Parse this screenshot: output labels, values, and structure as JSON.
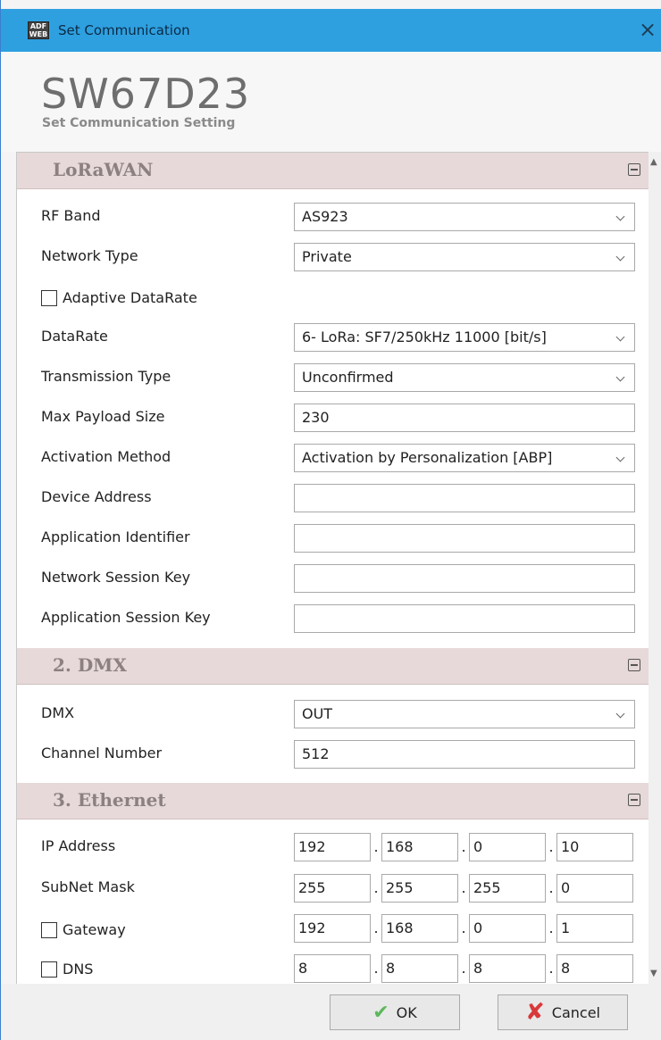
{
  "window": {
    "title": "Set Communication",
    "icon_text": "ADF WEB"
  },
  "header": {
    "product": "SW67D23",
    "subtitle": "Set Communication Setting"
  },
  "sections": {
    "lorawan": {
      "title": "LoRaWAN",
      "rf_band": {
        "label": "RF Band",
        "value": "AS923"
      },
      "network_type": {
        "label": "Network Type",
        "value": "Private"
      },
      "adaptive_datarate": {
        "label": "Adaptive DataRate",
        "checked": false
      },
      "datarate": {
        "label": "DataRate",
        "value": "6- LoRa: SF7/250kHz 11000 [bit/s]"
      },
      "transmission_type": {
        "label": "Transmission Type",
        "value": "Unconfirmed"
      },
      "max_payload": {
        "label": "Max Payload Size",
        "value": "230"
      },
      "activation_method": {
        "label": "Activation Method",
        "value": "Activation by Personalization [ABP]"
      },
      "device_address": {
        "label": "Device Address",
        "value": ""
      },
      "app_identifier": {
        "label": "Application Identifier",
        "value": ""
      },
      "network_session_key": {
        "label": "Network Session Key",
        "value": ""
      },
      "app_session_key": {
        "label": "Application Session Key",
        "value": ""
      }
    },
    "dmx": {
      "title": "2. DMX",
      "dmx": {
        "label": "DMX",
        "value": "OUT"
      },
      "channel_number": {
        "label": "Channel Number",
        "value": "512"
      }
    },
    "ethernet": {
      "title": "3. Ethernet",
      "ip_address": {
        "label": "IP Address",
        "octets": [
          "192",
          "168",
          "0",
          "10"
        ]
      },
      "subnet_mask": {
        "label": "SubNet Mask",
        "octets": [
          "255",
          "255",
          "255",
          "0"
        ]
      },
      "gateway": {
        "label": "Gateway",
        "checked": false,
        "octets": [
          "192",
          "168",
          "0",
          "1"
        ]
      },
      "dns": {
        "label": "DNS",
        "checked": false,
        "octets": [
          "8",
          "8",
          "8",
          "8"
        ]
      }
    }
  },
  "footer": {
    "ok_label": "OK",
    "cancel_label": "Cancel"
  },
  "colors": {
    "titlebar": "#2ea0e0",
    "section_header": "#e7d9d9"
  }
}
